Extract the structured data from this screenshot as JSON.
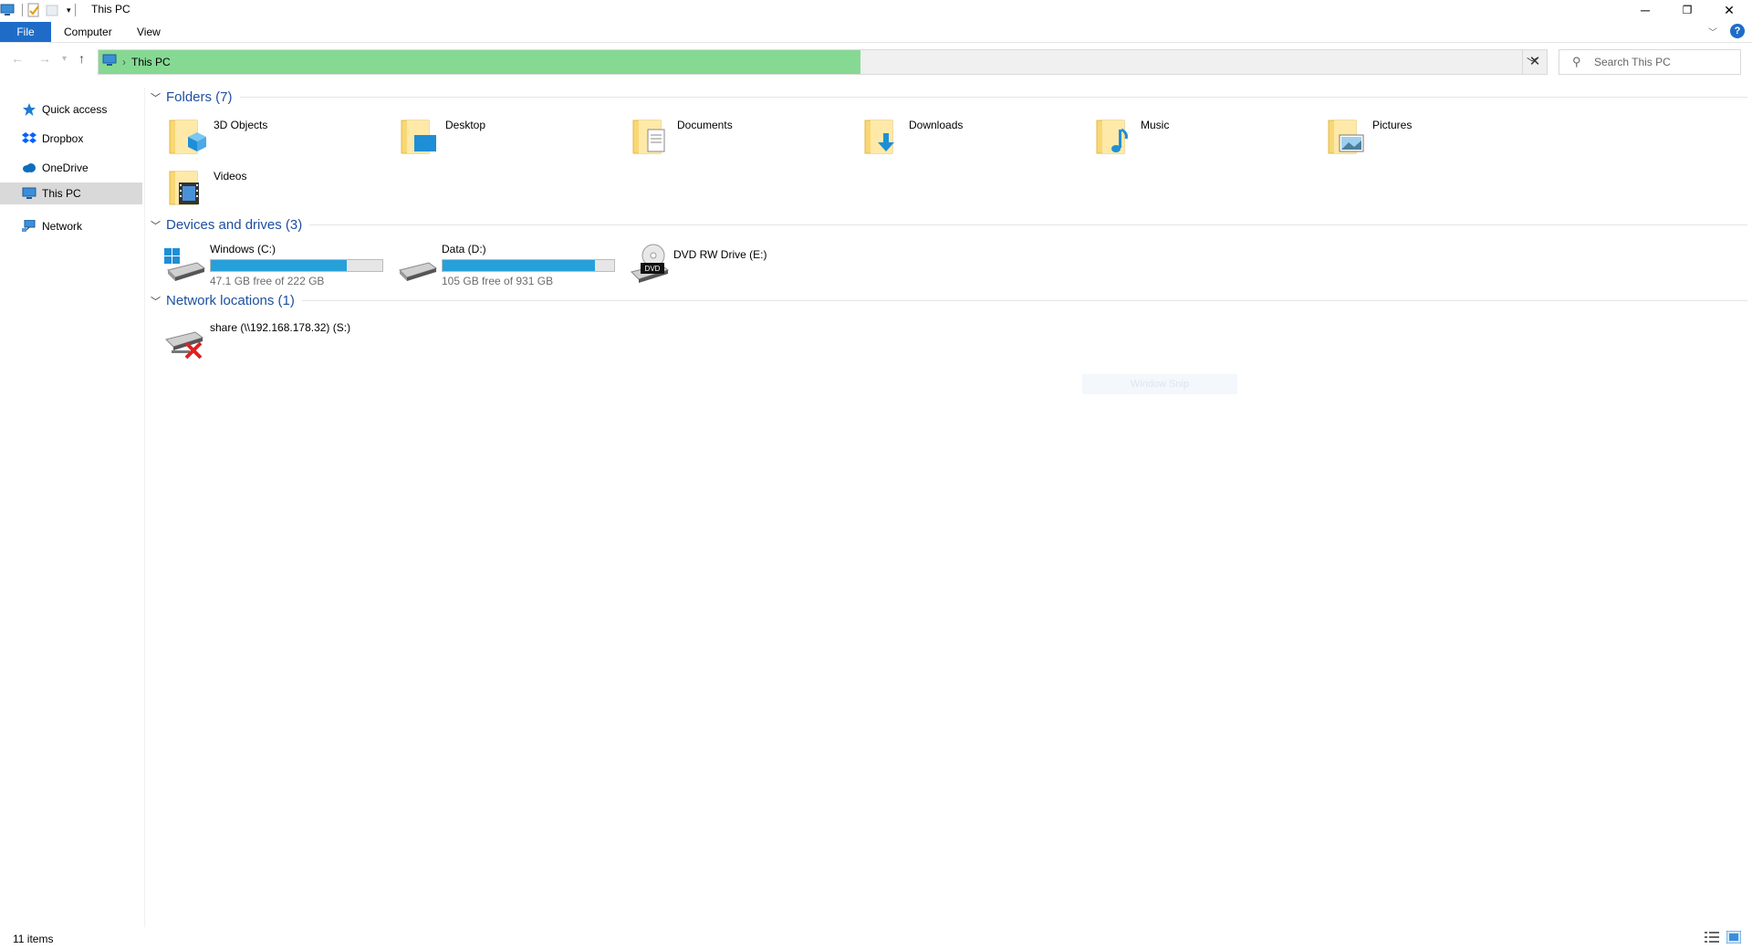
{
  "window": {
    "title": "This PC",
    "minimize_glyph": "─",
    "restore_glyph": "❐",
    "close_glyph": "✕"
  },
  "ribbon": {
    "tabs": [
      "File",
      "Computer",
      "View"
    ],
    "help_glyph": "?"
  },
  "address_bar": {
    "crumb": "This PC",
    "separator": "›"
  },
  "search": {
    "placeholder": "Search This PC"
  },
  "nav_pane": {
    "items": [
      {
        "label": "Quick access",
        "icon": "star-icon",
        "selected": false
      },
      {
        "label": "Dropbox",
        "icon": "dropbox-icon",
        "selected": false
      },
      {
        "label": "OneDrive",
        "icon": "cloud-icon",
        "selected": false
      },
      {
        "label": "This PC",
        "icon": "computer-icon",
        "selected": true
      },
      {
        "label": "Network",
        "icon": "network-icon",
        "selected": false
      }
    ]
  },
  "groups": {
    "folders": {
      "title": "Folders (7)",
      "items": [
        "3D Objects",
        "Desktop",
        "Documents",
        "Downloads",
        "Music",
        "Pictures",
        "Videos"
      ]
    },
    "drives": {
      "title": "Devices and drives (3)",
      "items": [
        {
          "name": "Windows (C:)",
          "free": "47.1 GB free of 222 GB",
          "used_fraction": 0.79
        },
        {
          "name": "Data (D:)",
          "free": "105 GB free of 931 GB",
          "used_fraction": 0.89
        },
        {
          "name": "DVD RW Drive (E:)"
        }
      ]
    },
    "network": {
      "title": "Network locations (1)",
      "items": [
        "share (\\\\192.168.178.32) (S:)"
      ]
    }
  },
  "snap_overlay": "Window Snip",
  "status_bar": {
    "count": "11 items"
  },
  "colors": {
    "accent": "#1e6cc8",
    "address_progress": "#86d993",
    "drive_bar": "#26a0da",
    "group_title": "#1e4fa0",
    "folder_yellow": "#f8d775"
  }
}
